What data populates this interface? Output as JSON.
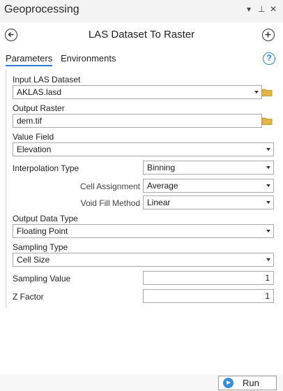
{
  "pane": {
    "title": "Geoprocessing",
    "menu_icon": "▾",
    "pin_icon": "⊥",
    "close_icon": "✕"
  },
  "tool": {
    "title": "LAS Dataset To Raster"
  },
  "tabs": [
    {
      "label": "Parameters",
      "active": true
    },
    {
      "label": "Environments",
      "active": false
    }
  ],
  "params": {
    "input_las": {
      "label": "Input LAS Dataset",
      "value": "AKLAS.lasd"
    },
    "output_raster": {
      "label": "Output Raster",
      "value": "dem.tif"
    },
    "value_field": {
      "label": "Value Field",
      "value": "Elevation"
    },
    "interpolation_type": {
      "label": "Interpolation Type",
      "value": "Binning"
    },
    "cell_assignment": {
      "label": "Cell Assignment",
      "value": "Average"
    },
    "void_fill": {
      "label": "Void Fill Method",
      "value": "Linear"
    },
    "output_data_type": {
      "label": "Output Data Type",
      "value": "Floating Point"
    },
    "sampling_type": {
      "label": "Sampling Type",
      "value": "Cell Size"
    },
    "sampling_value": {
      "label": "Sampling Value",
      "value": "1"
    },
    "z_factor": {
      "label": "Z Factor",
      "value": "1"
    }
  },
  "run": {
    "label": "Run"
  },
  "colors": {
    "accent": "#2a7fd4",
    "run_icon": "#3b8ed8",
    "folder": "#e3b443"
  }
}
